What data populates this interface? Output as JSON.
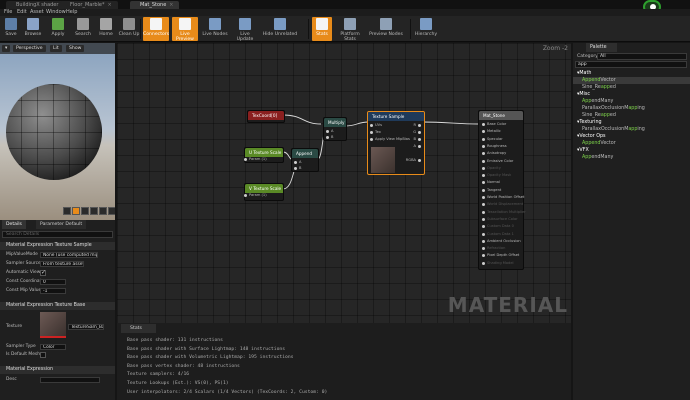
{
  "window": {
    "tabs": [
      {
        "label": "BuildingX shader",
        "active": false
      },
      {
        "label": "Floor_Marble*",
        "active": false
      },
      {
        "label": "Mat_Stone",
        "active": true
      }
    ]
  },
  "menu": [
    "File",
    "Edit",
    "Asset",
    "Window",
    "Help"
  ],
  "toolbar": [
    {
      "label": "Save",
      "icon": "save-icon",
      "state": "normal"
    },
    {
      "label": "Browse",
      "icon": "browse-icon",
      "state": "normal"
    },
    {
      "label": "Apply",
      "icon": "apply-icon",
      "state": "normal"
    },
    {
      "label": "Search",
      "icon": "search-icon",
      "state": "normal"
    },
    {
      "label": "Home",
      "icon": "home-icon",
      "state": "normal"
    },
    {
      "label": "Clean Up",
      "icon": "clean-up-icon",
      "state": "normal"
    },
    {
      "label": "Connectors",
      "icon": "connectors-icon",
      "state": "on"
    },
    {
      "label": "Live Preview",
      "icon": "live-preview-icon",
      "state": "on"
    },
    {
      "label": "Live Nodes",
      "icon": "live-nodes-icon",
      "state": "normal"
    },
    {
      "label": "Live Update",
      "icon": "live-update-icon",
      "state": "normal"
    },
    {
      "label": "Hide Unrelated",
      "icon": "hide-unrelated-icon",
      "state": "normal"
    },
    {
      "label": "Stats",
      "icon": "stats-icon",
      "state": "on"
    },
    {
      "label": "Platform Stats",
      "icon": "platform-stats-icon",
      "state": "normal"
    },
    {
      "label": "Preview Nodes",
      "icon": "preview-nodes-icon",
      "state": "normal"
    },
    {
      "label": "Hierarchy",
      "icon": "hierarchy-icon",
      "state": "normal"
    }
  ],
  "viewport": {
    "buttons": {
      "perspective": "Perspective",
      "lit": "Lit",
      "show": "Show"
    }
  },
  "details": {
    "tabs": {
      "details": "Details",
      "parameter_defaults": "Parameter Default"
    },
    "search_placeholder": "Search Details",
    "sections": {
      "texture_sample": "Material Expression Texture Sample",
      "texture_base": "Material Expression Texture Base",
      "expression": "Material Expression"
    },
    "mip_value_mode": {
      "label": "MipValueMode",
      "value": "None (use computed mip le"
    },
    "sampler_source": {
      "label": "Sampler Source",
      "value": "From texture asset"
    },
    "automatic_view": {
      "label": "Automatic View",
      "checked": true
    },
    "const_coordinate": {
      "label": "Const Coordinate",
      "value": "0"
    },
    "const_mip_value": {
      "label": "Const Mip Value",
      "value": "-1"
    },
    "texture": {
      "label": "Texture",
      "value": "TextureSam_Ba"
    },
    "sampler_type": {
      "label": "Sampler Type",
      "value": "Color"
    },
    "is_default_mesh": {
      "label": "Is Default Mesh",
      "checked": false
    },
    "desc": {
      "label": "Desc",
      "value": ""
    }
  },
  "graph": {
    "zoom": "Zoom -2",
    "watermark": "MATERIAL",
    "nodes": {
      "texcoord": {
        "title": "TexCoord[0]"
      },
      "multiply": {
        "title": "Multiply",
        "pins": [
          "A",
          "B"
        ]
      },
      "utile": {
        "title": "U Texture Scale",
        "sub": "Param (1)"
      },
      "vtile": {
        "title": "V Texture Scale",
        "sub": "Param (1)"
      },
      "append": {
        "title": "Append",
        "pins": [
          "A",
          "B"
        ]
      },
      "texsample": {
        "title": "Texture Sample",
        "inputs": [
          "UVs",
          "Tex",
          "Apply View MipBias"
        ],
        "outputs": [
          "R",
          "G",
          "B",
          "A",
          "RGBA"
        ]
      },
      "result": {
        "title": "Mat_Stone",
        "pins": [
          "Base Color",
          "Metallic",
          "Specular",
          "Roughness",
          "Anisotropy",
          "Emissive Color",
          "Opacity",
          "Opacity Mask",
          "Normal",
          "Tangent",
          "World Position Offset",
          "World Displacement",
          "Tessellation Multiplier",
          "Subsurface Color",
          "Custom Data 0",
          "Custom Data 1",
          "Ambient Occlusion",
          "Refraction",
          "Pixel Depth Offset",
          "Shading Model"
        ],
        "active": [
          true,
          true,
          true,
          true,
          true,
          true,
          false,
          false,
          true,
          true,
          true,
          false,
          false,
          false,
          false,
          false,
          true,
          false,
          true,
          false
        ]
      }
    }
  },
  "stats": {
    "tab": "Stats",
    "lines": [
      "Base pass shader: 131 instructions",
      "Base pass shader with Surface Lightmap: 148 instructions",
      "Base pass shader with Volumetric Lightmap: 195 instructions",
      "Base pass vertex shader: 48 instructions",
      "Texture samplers: 4/16",
      "Texture Lookups (Est.): VS(0), PS(1)",
      "User interpolators: 2/4 Scalars (1/4 Vectors) (TexCoords: 2, Custom: 0)"
    ]
  },
  "palette": {
    "tab": "Palette",
    "category_label": "Category",
    "category_value": "All",
    "search_value": "app",
    "items": [
      {
        "kind": "cat",
        "pre": "▾Math",
        "hl": "",
        "post": ""
      },
      {
        "kind": "it",
        "pre": "",
        "hl": "Append",
        "post": "Vector",
        "selected": true
      },
      {
        "kind": "it",
        "pre": "Sine_Re",
        "hl": "app",
        "post": "ed"
      },
      {
        "kind": "cat",
        "pre": "▾Misc",
        "hl": "",
        "post": ""
      },
      {
        "kind": "it",
        "pre": "",
        "hl": "App",
        "post": "endMany"
      },
      {
        "kind": "it",
        "pre": "ParallaxOcclusionM",
        "hl": "app",
        "post": "ing"
      },
      {
        "kind": "it",
        "pre": "Sine_Re",
        "hl": "app",
        "post": "ed"
      },
      {
        "kind": "cat",
        "pre": "▾Texturing",
        "hl": "",
        "post": ""
      },
      {
        "kind": "it",
        "pre": "ParallaxOcclusionM",
        "hl": "app",
        "post": "ing"
      },
      {
        "kind": "cat",
        "pre": "▾Vector Ops",
        "hl": "",
        "post": ""
      },
      {
        "kind": "it",
        "pre": "",
        "hl": "Append",
        "post": "Vector"
      },
      {
        "kind": "cat",
        "pre": "▾VFX",
        "hl": "",
        "post": ""
      },
      {
        "kind": "it",
        "pre": "",
        "hl": "App",
        "post": "endMany"
      }
    ]
  },
  "colors": {
    "toolbar_on": "#e88b1a",
    "node_param": "#5a8a26",
    "node_texcoord": "#8a1f1f",
    "node_texsample": "#1f3a5a",
    "node_math": "#2a4a44",
    "node_result": "#555555"
  }
}
